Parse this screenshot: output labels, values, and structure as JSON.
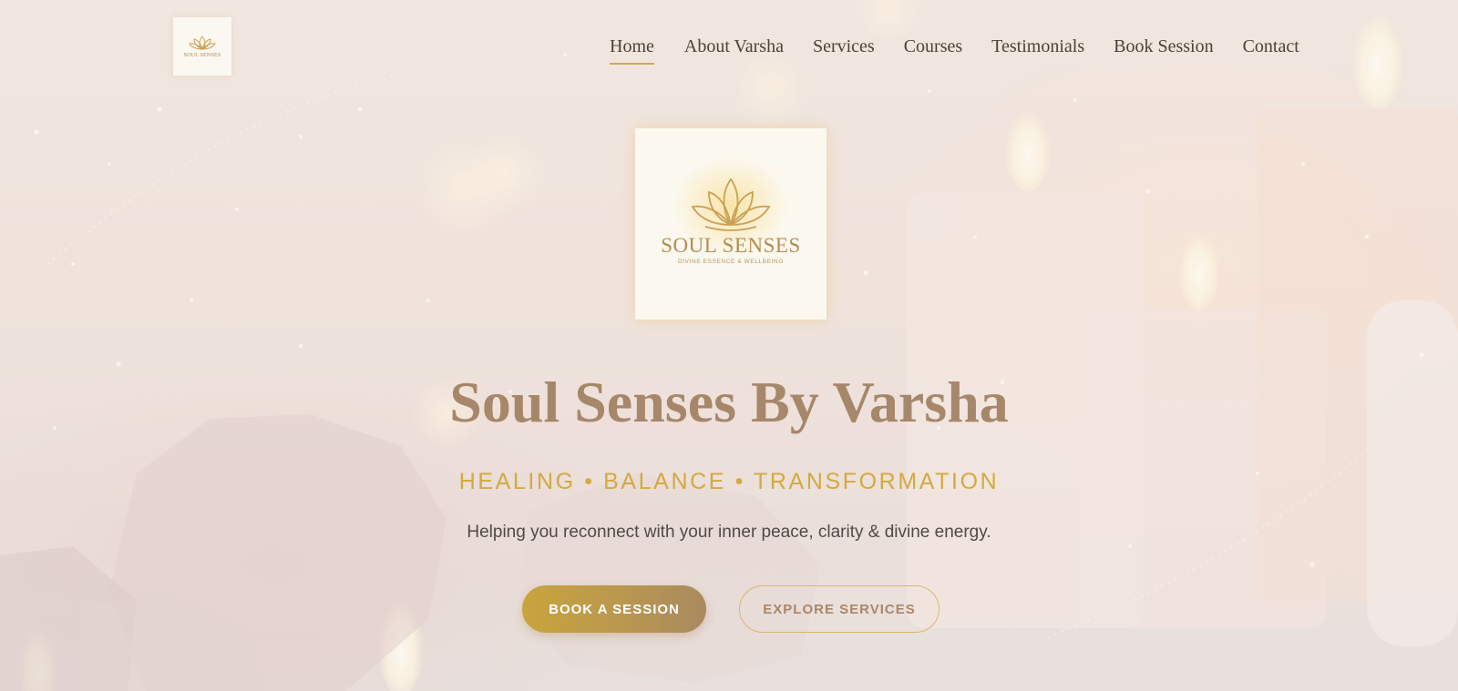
{
  "brand": {
    "logo_name": "SOUL SENSES",
    "logo_tagline": "DIVINE ESSENCE & WELLBEING"
  },
  "nav": {
    "items": [
      {
        "label": "Home",
        "active": true
      },
      {
        "label": "About Varsha"
      },
      {
        "label": "Services"
      },
      {
        "label": "Courses"
      },
      {
        "label": "Testimonials"
      },
      {
        "label": "Book Session"
      },
      {
        "label": "Contact"
      }
    ]
  },
  "hero": {
    "title": "Soul Senses By Varsha",
    "tagline": "HEALING • BALANCE • TRANSFORMATION",
    "description": "Helping you reconnect with your inner peace, clarity & divine energy.",
    "primary_button": "BOOK A SESSION",
    "secondary_button": "EXPLORE SERVICES"
  },
  "colors": {
    "gold_accent": "#d4a93e",
    "title_brown": "#a7876a",
    "nav_text": "#4e4036",
    "background": "#efe2d8"
  },
  "icons": {
    "logo": "lotus-icon"
  }
}
